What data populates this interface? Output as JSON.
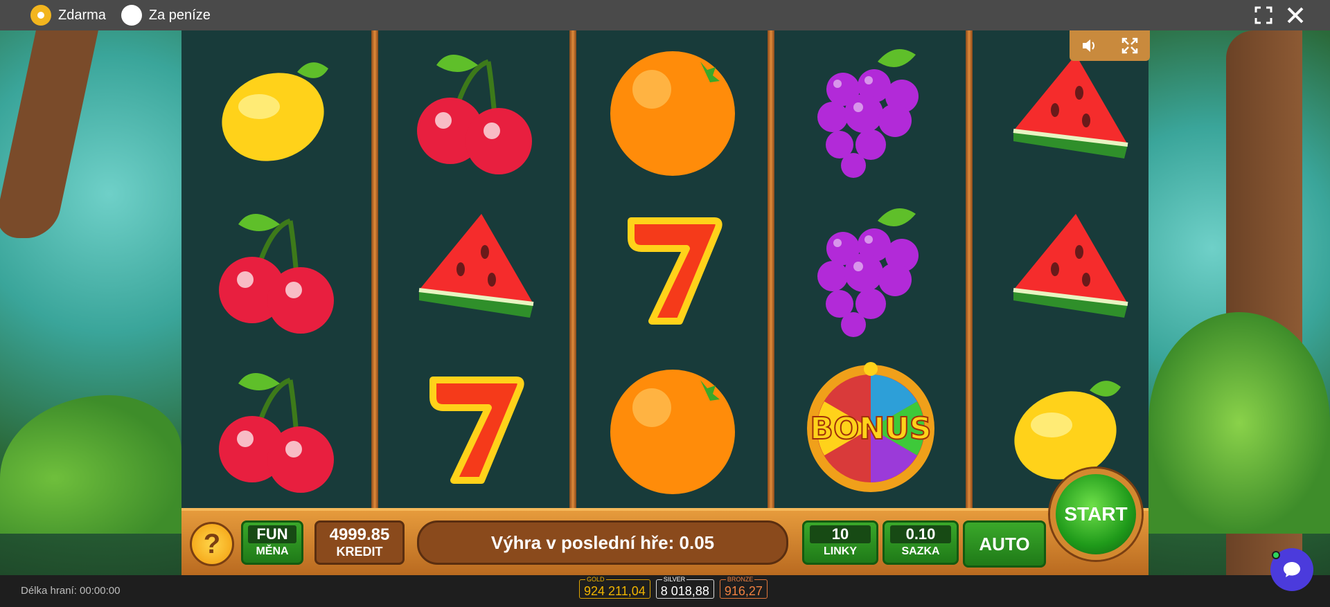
{
  "modes": [
    {
      "label": "Zdarma",
      "selected": true
    },
    {
      "label": "Za peníze",
      "selected": false
    }
  ],
  "top_icons": [
    "fullscreen-icon",
    "close-icon"
  ],
  "game_icons": [
    "speaker-icon",
    "expand-icon"
  ],
  "reels": [
    [
      "lemon",
      "cherry",
      "cherry"
    ],
    [
      "cherry",
      "watermelon",
      "seven"
    ],
    [
      "orange",
      "seven",
      "orange"
    ],
    [
      "grapes",
      "grapes",
      "bonus"
    ],
    [
      "watermelon",
      "watermelon",
      "lemon"
    ]
  ],
  "bonus_text": "BONUS",
  "panel": {
    "help_label": "?",
    "currency": {
      "value": "FUN",
      "label": "MĚNA"
    },
    "credit": {
      "value": "4999.85",
      "label": "KREDIT"
    },
    "last_win": "Výhra v poslední hře: 0.05",
    "lines": {
      "value": "10",
      "label": "LINKY"
    },
    "bet": {
      "value": "0.10",
      "label": "SAZKA"
    },
    "auto_label": "AUTO",
    "start_label": "START"
  },
  "bottom": {
    "play_time": "Délka hraní: 00:00:00",
    "jackpots": {
      "gold": {
        "title": "GOLD",
        "value": "924 211,04"
      },
      "silver": {
        "title": "SILVER",
        "value": "8 018,88"
      },
      "bronze": {
        "title": "BRONZE",
        "value": "916,27"
      }
    }
  },
  "colors": {
    "accent_yellow": "#f2b51e",
    "panel_orange": "#e69b3c",
    "start_green": "#1f9a1a",
    "chat_purple": "#4b3bdc"
  }
}
